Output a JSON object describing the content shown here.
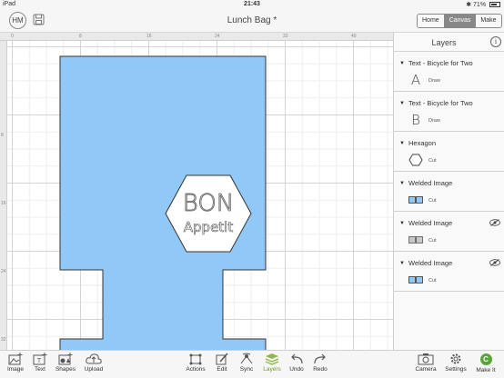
{
  "status": {
    "device": "iPad",
    "time": "21:43",
    "battery": "71%"
  },
  "header": {
    "avatar_initials": "HM",
    "project_title": "Lunch Bag *",
    "modes": [
      "Home",
      "Canvas",
      "Make"
    ],
    "active_mode": "Canvas"
  },
  "rulers": {
    "top": [
      "0",
      "8",
      "16",
      "24",
      "32",
      "40"
    ],
    "left": [
      "8",
      "16",
      "24",
      "32"
    ]
  },
  "canvas": {
    "text_line1": "BON",
    "text_line2": "Appetit",
    "colors": {
      "bag_fill": "#90c8f8",
      "outline": "#333333",
      "hexagon_fill": "#ffffff"
    }
  },
  "layers_panel": {
    "title": "Layers",
    "items": [
      {
        "name": "Text - Bicycle for Two",
        "thumb": "A",
        "operation": "Draw",
        "hidden": false,
        "thumb_type": "letter"
      },
      {
        "name": "Text - Bicycle for Two",
        "thumb": "B",
        "operation": "Draw",
        "hidden": false,
        "thumb_type": "letter"
      },
      {
        "name": "Hexagon",
        "thumb": "hexagon-icon",
        "operation": "Cut",
        "hidden": false,
        "thumb_type": "hexagon"
      },
      {
        "name": "Welded Image",
        "thumb": "welded-blue-icon",
        "operation": "Cut",
        "hidden": false,
        "thumb_type": "welded-blue"
      },
      {
        "name": "Welded Image",
        "thumb": "welded-gray-icon",
        "operation": "Cut",
        "hidden": true,
        "thumb_type": "welded-gray"
      },
      {
        "name": "Welded Image",
        "thumb": "welded-blue-icon",
        "operation": "Cut",
        "hidden": true,
        "thumb_type": "welded-blue"
      }
    ]
  },
  "bottom_tools": {
    "left": [
      {
        "label": "Image",
        "icon": "image-icon"
      },
      {
        "label": "Text",
        "icon": "text-icon"
      },
      {
        "label": "Shapes",
        "icon": "shapes-icon"
      },
      {
        "label": "Upload",
        "icon": "upload-icon"
      }
    ],
    "center": [
      {
        "label": "Actions",
        "icon": "actions-icon"
      },
      {
        "label": "Edit",
        "icon": "edit-icon"
      },
      {
        "label": "Sync",
        "icon": "sync-icon"
      },
      {
        "label": "Layers",
        "icon": "layers-icon",
        "active": true
      },
      {
        "label": "Undo",
        "icon": "undo-icon"
      },
      {
        "label": "Redo",
        "icon": "redo-icon"
      }
    ],
    "right": [
      {
        "label": "Camera",
        "icon": "camera-icon"
      },
      {
        "label": "Settings",
        "icon": "settings-icon"
      },
      {
        "label": "Make It",
        "icon": "make-it-icon",
        "badge": "C"
      }
    ],
    "active_color": "#6a9a2a"
  }
}
